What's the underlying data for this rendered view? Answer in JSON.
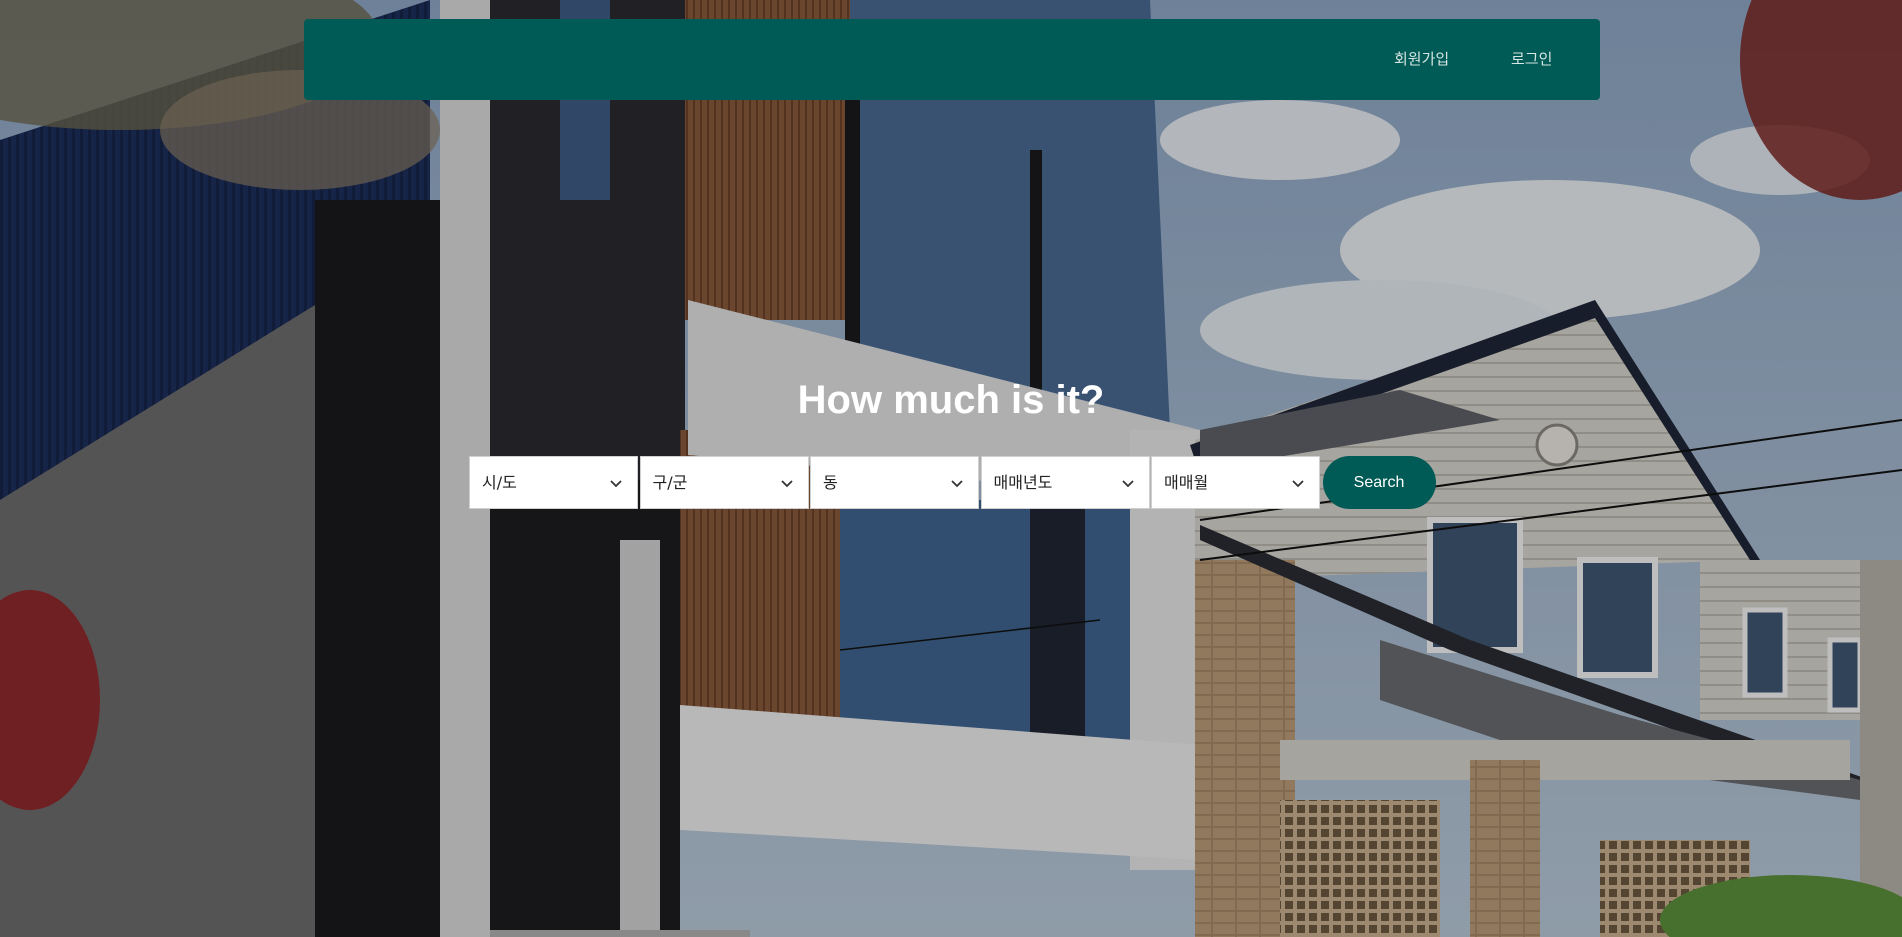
{
  "nav": {
    "signup_label": "회원가입",
    "login_label": "로그인",
    "background_color": "#005a55"
  },
  "hero": {
    "title": "How much is it?"
  },
  "search": {
    "selects": [
      {
        "label": "시/도",
        "icon": "chevron-down-icon"
      },
      {
        "label": "구/군",
        "icon": "chevron-down-icon"
      },
      {
        "label": "동",
        "icon": "chevron-down-icon"
      },
      {
        "label": "매매년도",
        "icon": "chevron-down-icon"
      },
      {
        "label": "매매월",
        "icon": "chevron-down-icon"
      }
    ],
    "button_label": "Search",
    "button_color": "#005a55"
  }
}
